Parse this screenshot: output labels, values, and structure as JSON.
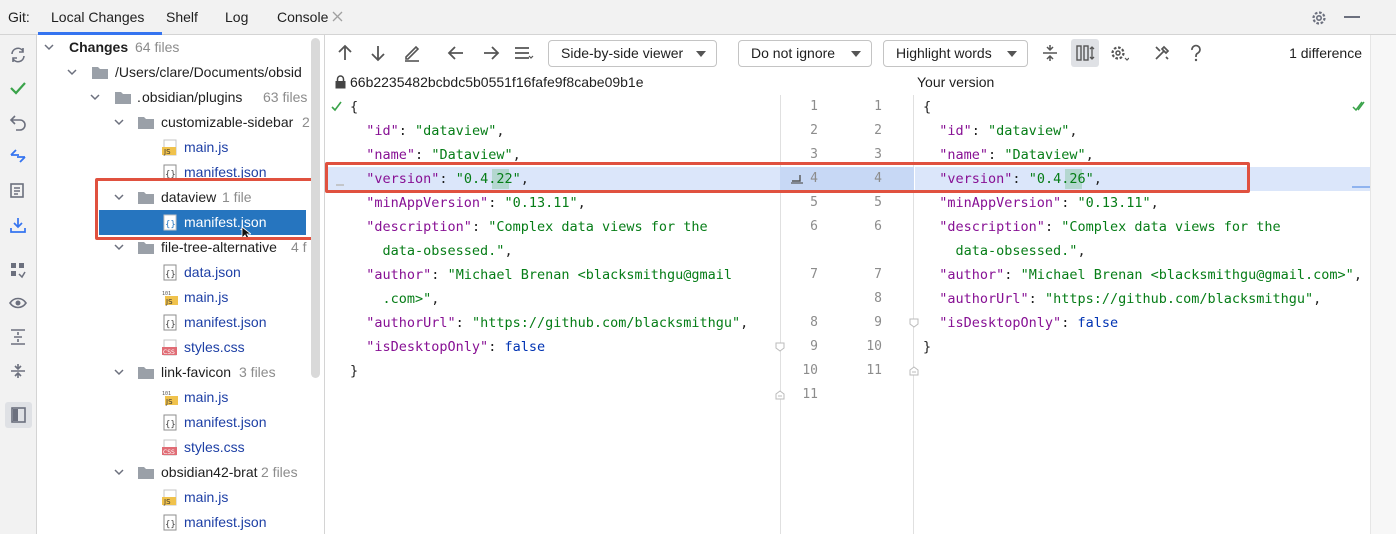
{
  "tabs": {
    "git_label": "Git:",
    "local_changes": "Local Changes",
    "shelf": "Shelf",
    "log": "Log",
    "console": "Console"
  },
  "tree": {
    "root_label": "Changes",
    "root_count": "64 files",
    "path": "/Users/clare/Documents/obsid",
    "plugins": "obsidian/plugins",
    "plugins_prefix": ".",
    "plugins_count": "63 files",
    "folders": {
      "customizable_sidebar": {
        "name": "customizable-sidebar",
        "count": "2"
      },
      "dataview": {
        "name": "dataview",
        "count": "1 file"
      },
      "file_tree_alternative": {
        "name": "file-tree-alternative",
        "count": "4 f"
      },
      "link_favicon": {
        "name": "link-favicon",
        "count": "3 files"
      },
      "obsidian42_brat": {
        "name": "obsidian42-brat",
        "count": "2 files"
      }
    },
    "files": {
      "cs_main": "main.js",
      "cs_manifest": "manifest.json",
      "dv_manifest": "manifest.json",
      "fta_data": "data.json",
      "fta_main": "main.js",
      "fta_manifest": "manifest.json",
      "fta_styles": "styles.css",
      "lf_main": "main.js",
      "lf_manifest": "manifest.json",
      "lf_styles": "styles.css",
      "ob_main": "main.js",
      "ob_manifest": "manifest.json"
    }
  },
  "toolbar": {
    "viewer": "Side-by-side viewer",
    "ignore": "Do not ignore",
    "highlight": "Highlight words",
    "difference_count": "1 difference"
  },
  "diff": {
    "left_header": "66b2235482bcbdc5b0551f16fafe9f8cabe09b1e",
    "right_header": "Your version",
    "left_line_numbers": [
      "1",
      "2",
      "3",
      "4",
      "5",
      "6",
      "",
      "7",
      "",
      "8",
      "9",
      "10",
      "11"
    ],
    "right_line_numbers": [
      "1",
      "2",
      "3",
      "4",
      "5",
      "6",
      "",
      "7",
      "8",
      "9",
      "10",
      "11"
    ]
  },
  "colors": {
    "accent": "#3574f0",
    "selection": "#2675bf",
    "annotation_red": "#e0513f",
    "changed_line": "#dbe6fa",
    "changed_word": "#b4d7d0"
  }
}
